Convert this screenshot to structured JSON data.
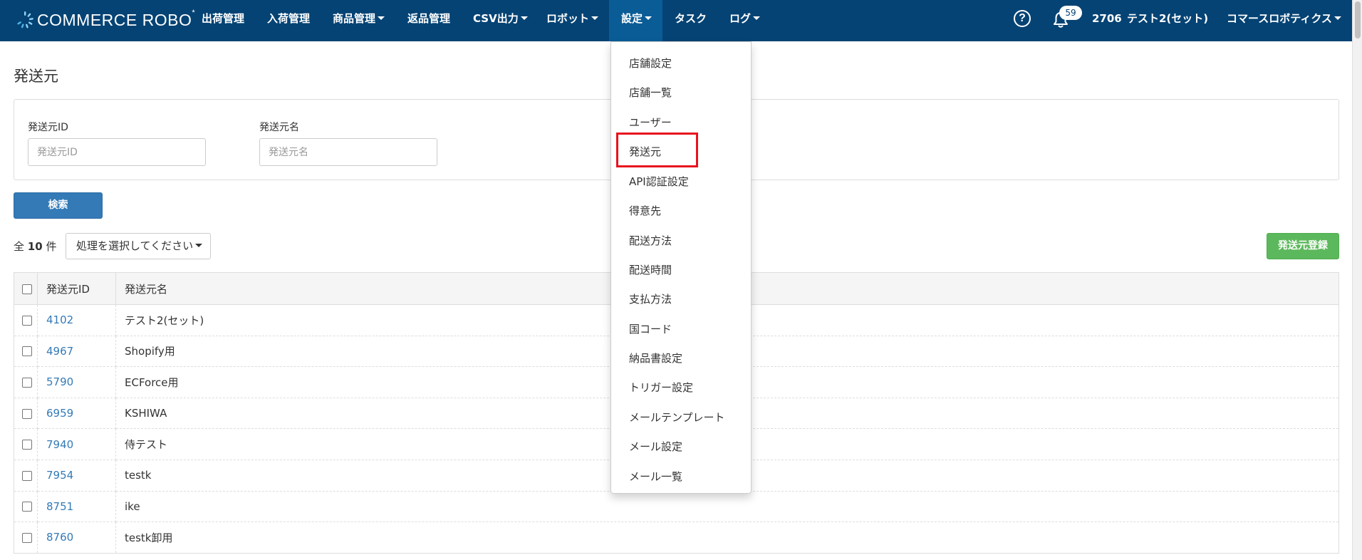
{
  "brand": {
    "logo_text": "COMMERCE ROBO",
    "logo_mark": "*"
  },
  "nav": {
    "items": [
      {
        "label": "出荷管理",
        "has_caret": false
      },
      {
        "label": "入荷管理",
        "has_caret": false
      },
      {
        "label": "商品管理",
        "has_caret": true
      },
      {
        "label": "返品管理",
        "has_caret": false
      },
      {
        "label": "CSV出力",
        "has_caret": true
      },
      {
        "label": "ロボット",
        "has_caret": true
      },
      {
        "label": "設定",
        "has_caret": true
      },
      {
        "label": "タスク",
        "has_caret": false
      },
      {
        "label": "ログ",
        "has_caret": true
      }
    ],
    "active_item": "設定",
    "help_icon": "?",
    "notification_count": "59",
    "shop_id": "2706",
    "shop_name": "テスト2(セット)",
    "company_name": "コマースロボティクス"
  },
  "page": {
    "title": "発送元"
  },
  "search": {
    "id_label": "発送元ID",
    "id_placeholder": "発送元ID",
    "id_value": "",
    "name_label": "発送元名",
    "name_placeholder": "発送元名",
    "name_value": "",
    "search_button": "検索"
  },
  "toolbar": {
    "total_prefix": "全",
    "total_count": "10",
    "total_suffix": "件",
    "bulk_action_placeholder": "処理を選択してください",
    "register_button": "発送元登録"
  },
  "table": {
    "columns": [
      "発送元ID",
      "発送元名"
    ],
    "rows": [
      {
        "id": "4102",
        "name": "テスト2(セット)"
      },
      {
        "id": "4967",
        "name": "Shopify用"
      },
      {
        "id": "5790",
        "name": "ECForce用"
      },
      {
        "id": "6959",
        "name": "KSHIWA"
      },
      {
        "id": "7940",
        "name": "侍テスト"
      },
      {
        "id": "7954",
        "name": "testk"
      },
      {
        "id": "8751",
        "name": "ike"
      },
      {
        "id": "8760",
        "name": "testk卸用"
      }
    ]
  },
  "settings_menu": {
    "items": [
      "店舗設定",
      "店舗一覧",
      "ユーザー",
      "発送元",
      "API認証設定",
      "得意先",
      "配送方法",
      "配送時間",
      "支払方法",
      "国コード",
      "納品書設定",
      "トリガー設定",
      "メールテンプレート",
      "メール設定",
      "メール一覧"
    ],
    "highlighted_item": "発送元"
  },
  "colors": {
    "navbar": "#054374",
    "navbar_active": "#0a5c96",
    "primary_button": "#337ab7",
    "success_button": "#5cb85c",
    "link": "#337ab7",
    "highlight_border": "#e8121e"
  }
}
